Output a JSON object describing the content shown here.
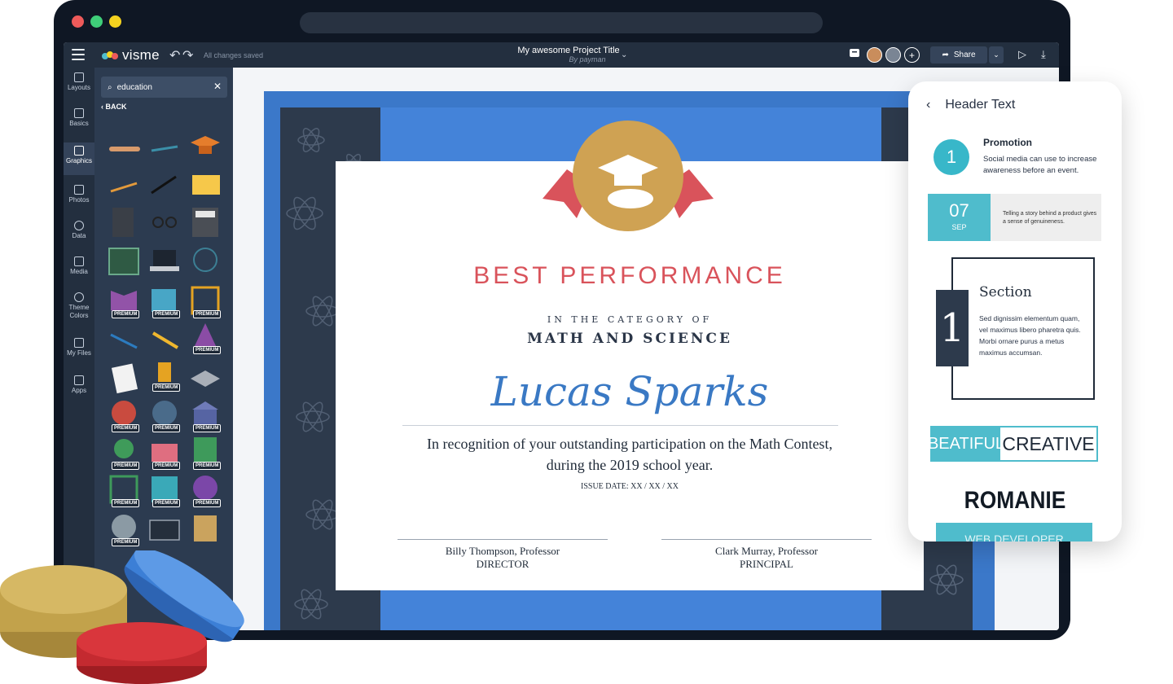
{
  "topbar": {
    "logo": "visme",
    "saved_status": "All changes saved",
    "project_title": "My awesome Project Title",
    "byline": "By payman",
    "share_label": "Share"
  },
  "leftnav": {
    "items": [
      {
        "label": "Layouts"
      },
      {
        "label": "Basics"
      },
      {
        "label": "Graphics"
      },
      {
        "label": "Photos"
      },
      {
        "label": "Data"
      },
      {
        "label": "Media"
      },
      {
        "label": "Theme Colors"
      },
      {
        "label": "My Files"
      },
      {
        "label": "Apps"
      }
    ]
  },
  "panel": {
    "search_value": "education",
    "back_label": "BACK",
    "premium_badge": "PREMIUM"
  },
  "certificate": {
    "title": "BEST PERFORMANCE",
    "category_line": "IN THE CATEGORY OF",
    "category": "MATH AND SCIENCE",
    "recipient": "Lucas Sparks",
    "recognition_line1": "In recognition of your outstanding participation on the Math Contest,",
    "recognition_line2": "during the 2019 school year.",
    "issue_date": "ISSUE DATE: XX / XX / XX",
    "signer1_name": "Billy Thompson, Professor",
    "signer1_role": "DIRECTOR",
    "signer2_name": "Clark Murray, Professor",
    "signer2_role": "PRINCIPAL"
  },
  "phone": {
    "header": "Header Text",
    "promo_number": "1",
    "promo_title": "Promotion",
    "promo_desc": "Social media can use to increase awareness before an event.",
    "date_day": "07",
    "date_month": "SEP",
    "date_desc": "Telling a story behind a product gives a sense of genuineness.",
    "section_number": "1",
    "section_title": "Section",
    "section_desc": "Sed dignissim elementum quam, vel maximus libero pharetra quis. Morbi ornare purus a metus maximus accumsan.",
    "creative_a": "BEATIFUL",
    "creative_b": "CREATIVE",
    "romanie": "ROMANIE",
    "bottom_text": "WEB DEVELOPER"
  },
  "colors": {
    "accent_teal": "#4fbccc",
    "cert_red": "#d9535b",
    "cert_blue": "#4483d9",
    "dark_navy": "#232f3f"
  }
}
